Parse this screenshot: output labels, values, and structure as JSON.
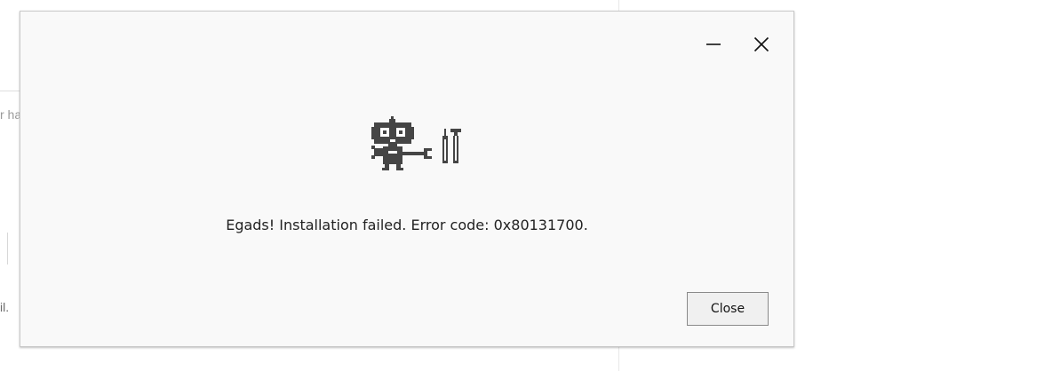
{
  "background_window": {
    "fragment_1": "r ha",
    "fragment_2": "il."
  },
  "dialog": {
    "titlebar": {
      "minimize_icon": "minimize-icon",
      "close_icon": "close-icon"
    },
    "illustration_icon": "robot-with-tools-icon",
    "message": "Egads! Installation failed. Error code: 0x80131700.",
    "close_label": "Close"
  },
  "colors": {
    "dialog_background": "#f9f9f9",
    "icon_color": "#454545",
    "text_color": "#222222",
    "button_border": "#8a8a8a"
  }
}
